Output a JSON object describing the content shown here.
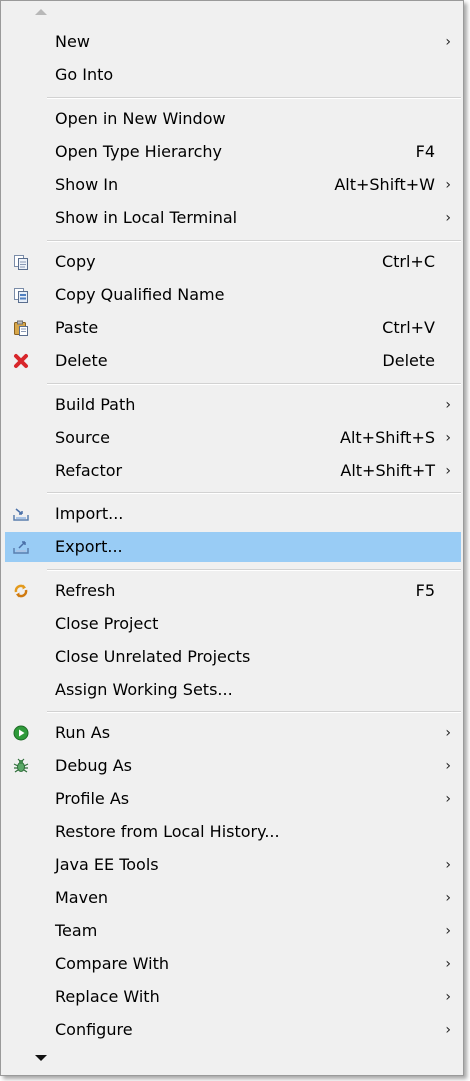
{
  "menu": {
    "items": [
      {
        "label": "New",
        "shortcut": "",
        "submenu": true
      },
      {
        "label": "Go Into",
        "shortcut": "",
        "submenu": false
      },
      {
        "label": "Open in New Window",
        "shortcut": "",
        "submenu": false
      },
      {
        "label": "Open Type Hierarchy",
        "shortcut": "F4",
        "submenu": false
      },
      {
        "label": "Show In",
        "shortcut": "Alt+Shift+W",
        "submenu": true
      },
      {
        "label": "Show in Local Terminal",
        "shortcut": "",
        "submenu": true
      },
      {
        "label": "Copy",
        "shortcut": "Ctrl+C",
        "submenu": false,
        "icon": "copy-icon"
      },
      {
        "label": "Copy Qualified Name",
        "shortcut": "",
        "submenu": false,
        "icon": "copy-qualified-name-icon"
      },
      {
        "label": "Paste",
        "shortcut": "Ctrl+V",
        "submenu": false,
        "icon": "paste-icon"
      },
      {
        "label": "Delete",
        "shortcut": "Delete",
        "submenu": false,
        "icon": "delete-icon"
      },
      {
        "label": "Build Path",
        "shortcut": "",
        "submenu": true
      },
      {
        "label": "Source",
        "shortcut": "Alt+Shift+S",
        "submenu": true
      },
      {
        "label": "Refactor",
        "shortcut": "Alt+Shift+T",
        "submenu": true
      },
      {
        "label": "Import...",
        "shortcut": "",
        "submenu": false,
        "icon": "import-icon"
      },
      {
        "label": "Export...",
        "shortcut": "",
        "submenu": false,
        "icon": "export-icon",
        "highlighted": true
      },
      {
        "label": "Refresh",
        "shortcut": "F5",
        "submenu": false,
        "icon": "refresh-icon"
      },
      {
        "label": "Close Project",
        "shortcut": "",
        "submenu": false
      },
      {
        "label": "Close Unrelated Projects",
        "shortcut": "",
        "submenu": false
      },
      {
        "label": "Assign Working Sets...",
        "shortcut": "",
        "submenu": false
      },
      {
        "label": "Run As",
        "shortcut": "",
        "submenu": true,
        "icon": "run-icon"
      },
      {
        "label": "Debug As",
        "shortcut": "",
        "submenu": true,
        "icon": "debug-bug-icon"
      },
      {
        "label": "Profile As",
        "shortcut": "",
        "submenu": true
      },
      {
        "label": "Restore from Local History...",
        "shortcut": "",
        "submenu": false
      },
      {
        "label": "Java EE Tools",
        "shortcut": "",
        "submenu": true
      },
      {
        "label": "Maven",
        "shortcut": "",
        "submenu": true
      },
      {
        "label": "Team",
        "shortcut": "",
        "submenu": true
      },
      {
        "label": "Compare With",
        "shortcut": "",
        "submenu": true
      },
      {
        "label": "Replace With",
        "shortcut": "",
        "submenu": true
      },
      {
        "label": "Configure",
        "shortcut": "",
        "submenu": true
      }
    ],
    "submenu_glyph": "›",
    "colors": {
      "highlight": "#99ccf5",
      "background": "#f0f0f0",
      "separator": "#d2d2d2"
    }
  }
}
